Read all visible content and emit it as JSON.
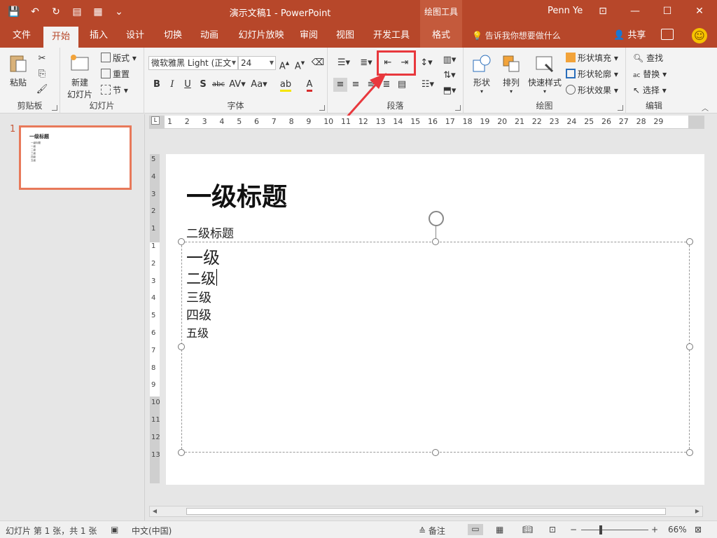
{
  "app": {
    "doc_title": "演示文稿1 - PowerPoint",
    "context_title": "绘图工具",
    "user": "Penn Ye"
  },
  "tabs": [
    {
      "label": "文件"
    },
    {
      "label": "开始"
    },
    {
      "label": "插入"
    },
    {
      "label": "设计"
    },
    {
      "label": "切换"
    },
    {
      "label": "动画"
    },
    {
      "label": "幻灯片放映"
    },
    {
      "label": "审阅"
    },
    {
      "label": "视图"
    },
    {
      "label": "开发工具"
    },
    {
      "label": "格式"
    }
  ],
  "tell_me": "告诉我你想要做什么",
  "share": "共享",
  "ribbon": {
    "clipboard": {
      "label": "剪贴板",
      "paste": "粘贴"
    },
    "slides": {
      "label": "幻灯片",
      "new_slide_line1": "新建",
      "new_slide_line2": "幻灯片",
      "layout": "版式",
      "reset": "重置",
      "section": "节"
    },
    "font": {
      "label": "字体",
      "font_name": "微软雅黑 Light (正文",
      "font_size": "24"
    },
    "paragraph": {
      "label": "段落"
    },
    "drawing": {
      "label": "绘图",
      "shapes": "形状",
      "arrange": "排列",
      "quick_styles": "快速样式",
      "shape_fill": "形状填充",
      "shape_outline": "形状轮廓",
      "shape_effects": "形状效果"
    },
    "editing": {
      "label": "编辑",
      "find": "查找",
      "replace": "替换",
      "select": "选择"
    }
  },
  "thumbnail": {
    "number": "1",
    "title": "一级标题",
    "lines": [
      "一级标题",
      "一级",
      "二级",
      "三级",
      "四级",
      "五级"
    ]
  },
  "hruler": [
    "1",
    "2",
    "3",
    "4",
    "5",
    "6",
    "7",
    "8",
    "9",
    "10",
    "11",
    "12",
    "13",
    "14",
    "15",
    "16",
    "17",
    "18",
    "19",
    "20",
    "21",
    "22",
    "23",
    "24",
    "25",
    "26",
    "27",
    "28",
    "29"
  ],
  "vruler": [
    "5",
    "4",
    "3",
    "2",
    "1",
    "1",
    "2",
    "3",
    "4",
    "5",
    "6",
    "7",
    "8",
    "9",
    "10",
    "11",
    "12",
    "13"
  ],
  "slide": {
    "title": "一级标题",
    "subtitle": "二级标题",
    "levels": [
      "一级",
      "二级",
      "三级",
      "四级",
      "五级"
    ]
  },
  "status": {
    "slide_info": "幻灯片 第 1 张，共 1 张",
    "language": "中文(中国)",
    "notes": "备注",
    "zoom": "66%"
  },
  "colors": {
    "accent": "#b7472a",
    "highlight": "#e8383d"
  }
}
